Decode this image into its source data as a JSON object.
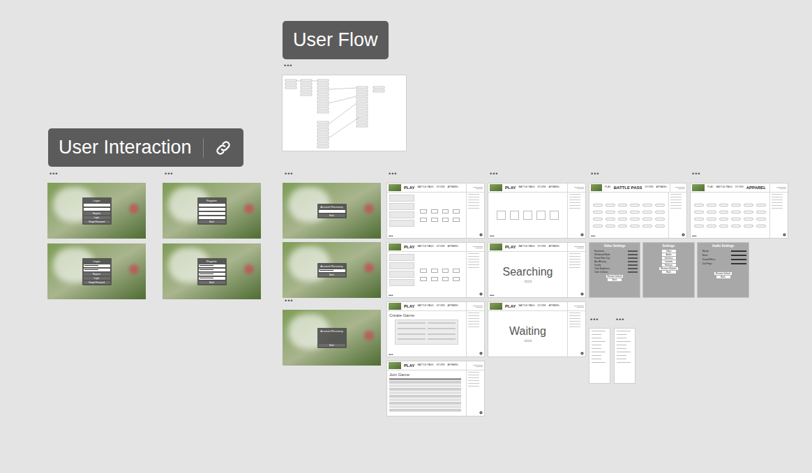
{
  "canvas": {
    "sections": [
      {
        "title": "User Flow",
        "link": false
      },
      {
        "title": "User Interaction",
        "link": true
      }
    ],
    "frames": [
      {
        "kind": "flow",
        "label": "•••"
      },
      {
        "kind": "auth",
        "label": "•••",
        "title": "Login",
        "fields": [
          {
            "filled": false
          },
          {
            "filled": false
          }
        ],
        "buttons": [
          "Register",
          "Login",
          "Forgot Password"
        ]
      },
      {
        "kind": "auth",
        "title": "Login",
        "fields": [
          {
            "filled": true
          },
          {
            "filled": true
          }
        ],
        "buttons": [
          "Register",
          "Login",
          "Forgot Password"
        ]
      },
      {
        "kind": "auth",
        "label": "•••",
        "title": "Register",
        "fields": [
          {
            "filled": false
          },
          {
            "filled": false
          },
          {
            "filled": false
          },
          {
            "filled": false
          }
        ],
        "buttons": [
          "Back"
        ]
      },
      {
        "kind": "auth",
        "title": "Register",
        "fields": [
          {
            "filled": true
          },
          {
            "filled": true
          },
          {
            "filled": true
          },
          {
            "filled": true
          }
        ],
        "buttons": [
          "Back"
        ]
      },
      {
        "kind": "auth",
        "label": "•••",
        "title": "Account Recovery",
        "fields": [
          {
            "filled": false
          }
        ],
        "buttons": [
          "Back"
        ]
      },
      {
        "kind": "auth",
        "title": "Account Recovery",
        "fields": [
          {
            "filled": true
          }
        ],
        "buttons": [
          "Back"
        ]
      },
      {
        "kind": "auth",
        "label": "•••",
        "title": "Account Recovery",
        "fields": [],
        "buttons": [
          "Back"
        ]
      },
      {
        "kind": "game",
        "label": "•••",
        "view": "modes",
        "dots": "•••",
        "tabs": [
          {
            "label": "PLAY",
            "selected": true
          },
          {
            "label": "BATTLE PASS",
            "selected": false
          },
          {
            "label": "STORE",
            "selected": false
          },
          {
            "label": "APPAREL",
            "selected": false
          }
        ]
      },
      {
        "kind": "game",
        "view": "modes",
        "dots": "•••",
        "tabs": [
          {
            "label": "PLAY",
            "selected": true
          },
          {
            "label": "BATTLE PASS",
            "selected": false
          },
          {
            "label": "STORE",
            "selected": false
          },
          {
            "label": "APPAREL",
            "selected": false
          }
        ]
      },
      {
        "kind": "game",
        "view": "form",
        "heading": "Create Game",
        "dots": "•••",
        "tabs": [
          {
            "label": "PLAY",
            "selected": true
          },
          {
            "label": "BATTLE PASS",
            "selected": false
          },
          {
            "label": "STORE",
            "selected": false
          },
          {
            "label": "APPAREL",
            "selected": false
          }
        ]
      },
      {
        "kind": "game",
        "view": "table",
        "heading": "Join Game",
        "tabs": [
          {
            "label": "PLAY",
            "selected": true
          },
          {
            "label": "BATTLE PASS",
            "selected": false
          },
          {
            "label": "STORE",
            "selected": false
          },
          {
            "label": "APPAREL",
            "selected": false
          }
        ]
      },
      {
        "kind": "game",
        "label": "•••",
        "view": "cards",
        "dots": "•••",
        "tabs": [
          {
            "label": "PLAY",
            "selected": true
          },
          {
            "label": "BATTLE PASS",
            "selected": false
          },
          {
            "label": "STORE",
            "selected": false
          },
          {
            "label": "APPAREL",
            "selected": false
          }
        ]
      },
      {
        "kind": "game",
        "view": "heading",
        "heading": "Searching",
        "dots": "•••",
        "tabs": [
          {
            "label": "PLAY",
            "selected": true
          },
          {
            "label": "BATTLE PASS",
            "selected": false
          },
          {
            "label": "STORE",
            "selected": false
          },
          {
            "label": "APPAREL",
            "selected": false
          }
        ]
      },
      {
        "kind": "game",
        "view": "heading",
        "heading": "Waiting",
        "tabs": [
          {
            "label": "PLAY",
            "selected": true
          },
          {
            "label": "BATTLE PASS",
            "selected": false
          },
          {
            "label": "STORE",
            "selected": false
          },
          {
            "label": "APPAREL",
            "selected": false
          }
        ]
      },
      {
        "kind": "game",
        "label": "•••",
        "view": "grid",
        "dots": "•••",
        "tabs": [
          {
            "label": "PLAY",
            "selected": false
          },
          {
            "label": "BATTLE PASS",
            "selected": true
          },
          {
            "label": "STORE",
            "selected": false
          },
          {
            "label": "APPAREL",
            "selected": false
          }
        ]
      },
      {
        "kind": "game",
        "label": "•••",
        "view": "grid",
        "dots": "•••",
        "tabs": [
          {
            "label": "PLAY",
            "selected": false
          },
          {
            "label": "BATTLE PASS",
            "selected": false
          },
          {
            "label": "STORE",
            "selected": false
          },
          {
            "label": "APPAREL",
            "selected": true
          }
        ]
      },
      {
        "kind": "settings",
        "view": "video",
        "title": "Video Settings",
        "rows": [
          "Resolution",
          "Windowed Mode",
          "Frame Rate Cap",
          "Anti-Aliasing",
          "Quality",
          "Color Brightness",
          "Color Contrast"
        ],
        "buttons": [
          "Restore Default",
          "Back"
        ]
      },
      {
        "kind": "settings",
        "view": "menu",
        "title": "Settings",
        "rows": [],
        "buttons": [
          "Video",
          "Audio",
          "Interface",
          "Controls",
          "Hotkeys",
          "Restore Defaults",
          "Back"
        ]
      },
      {
        "kind": "settings",
        "view": "audio",
        "title": "Audio Settings",
        "rows": [
          "Master",
          "Music",
          "Sound Effects",
          "Dial Pings"
        ],
        "levels": [
          1,
          1,
          1,
          1
        ],
        "buttons": [
          "Restore Default",
          "Back"
        ]
      },
      {
        "kind": "mini",
        "label": "•••"
      },
      {
        "kind": "mini",
        "label": "•••"
      }
    ]
  }
}
